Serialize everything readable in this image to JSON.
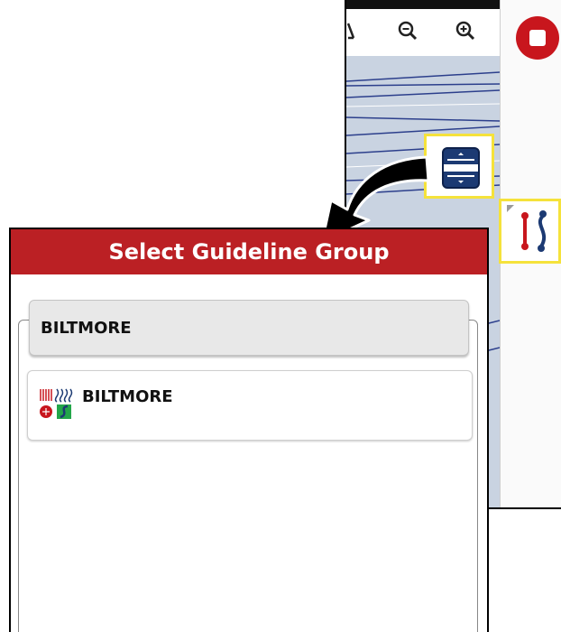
{
  "dialog": {
    "title": "Select Guideline Group",
    "group_header": "BILTMORE",
    "items": [
      {
        "label": "BILTMORE",
        "icon": "guideline-pattern-icon"
      }
    ]
  },
  "toolbar": {
    "icons": [
      "zoom-out-icon",
      "zoom-in-icon",
      "stop-icon"
    ]
  },
  "colors": {
    "header_red": "#bb2024",
    "stop_red": "#c8161d",
    "highlight_yellow": "#f5e23b",
    "guideline_blue": "#1c3a73"
  }
}
